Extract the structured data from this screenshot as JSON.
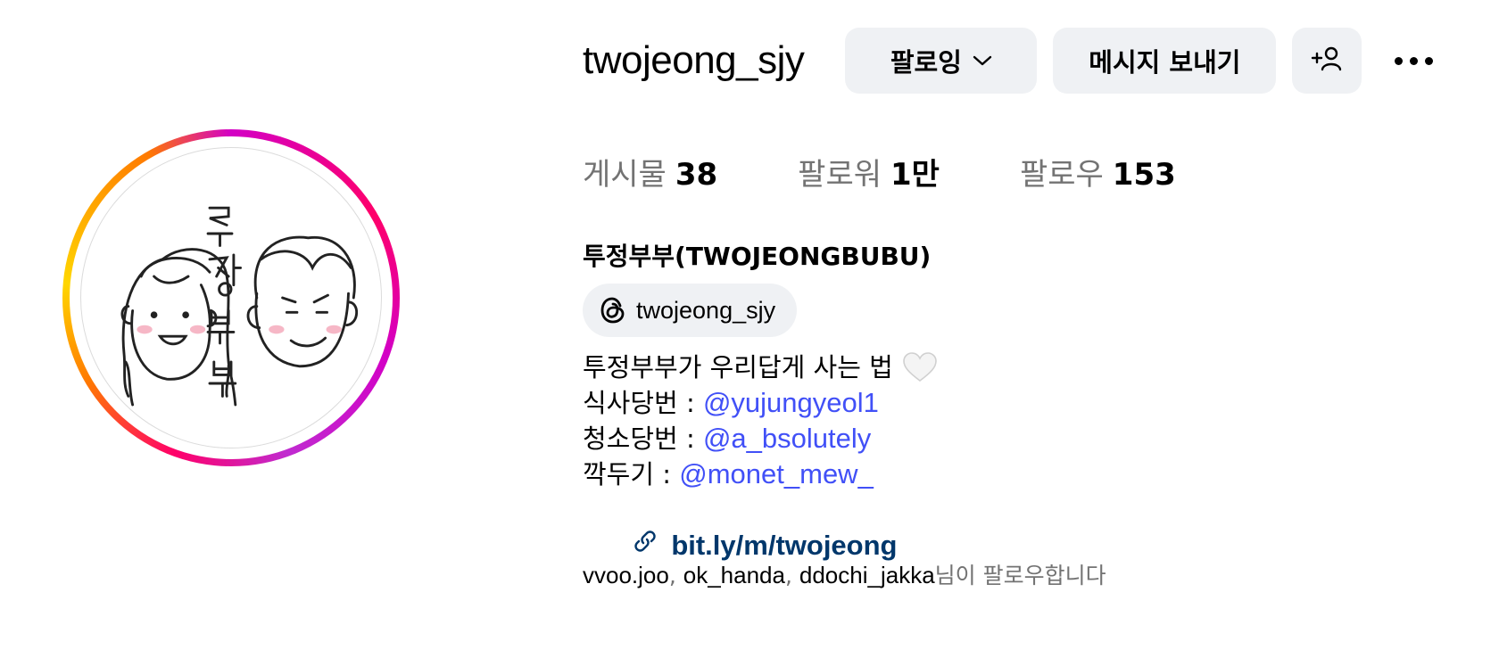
{
  "profile": {
    "username": "twojeong_sjy",
    "full_name": "투정부부(TWOJEONGBUBU)",
    "avatar_text": "투정부부"
  },
  "actions": {
    "follow_label": "팔로잉",
    "message_label": "메시지 보내기",
    "add_user_icon": "add-person-icon",
    "more_icon": "ellipsis-icon"
  },
  "stats": {
    "posts_label": "게시물",
    "posts_value": "38",
    "followers_label": "팔로워",
    "followers_value": "1만",
    "following_label": "팔로우",
    "following_value": "153"
  },
  "threads": {
    "handle": "twojeong_sjy",
    "icon": "threads-icon"
  },
  "bio": {
    "line1": "투정부부가 우리답게 사는 법",
    "line1_emoji": "white-heart",
    "line2_prefix": "식사당번 : ",
    "line2_mention": "@yujungyeol1",
    "line3_prefix": "청소당번 : ",
    "line3_mention": "@a_bsolutely",
    "line4_prefix": "깍두기 : ",
    "line4_mention": "@monet_mew_",
    "link": "bit.ly/m/twojeong"
  },
  "followed_by": {
    "names": [
      "vvoo.joo",
      "ok_handa",
      "ddochi_jakka"
    ],
    "separator": ", ",
    "suffix": "님이 팔로우합니다"
  },
  "colors": {
    "button_bg": "#eff1f4",
    "mention": "#4150f7",
    "link": "#00376b",
    "muted": "#737373"
  }
}
